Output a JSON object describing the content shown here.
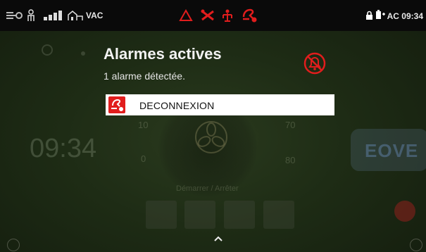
{
  "status_bar": {
    "mode_text": "VAC",
    "time_text": "AC 09:34",
    "icons_left": [
      "tubing-icon",
      "patient-icon",
      "signal-icon",
      "building-icon"
    ],
    "icons_center": [
      "alarm-triangle-icon",
      "tools-icon",
      "person-network-icon",
      "disconnection-alarm-icon"
    ],
    "icons_right": [
      "lock-icon",
      "battery-plug-icon"
    ],
    "alert_color": "#e11d1d"
  },
  "background": {
    "clock": "09:34",
    "gauge_ticks": [
      "10",
      "0",
      "70",
      "80"
    ],
    "caption": "Démarrer / Arrêter",
    "logo": "EOVE"
  },
  "alarm_popup": {
    "title": "Alarmes actives",
    "subtitle": "1 alarme détectée.",
    "alarms": [
      {
        "label": "DECONNEXION",
        "icon": "disconnection-icon"
      }
    ],
    "mute_icon": "alarm-muted-icon"
  },
  "footer": {
    "chevron": "chevron-up-icon"
  }
}
